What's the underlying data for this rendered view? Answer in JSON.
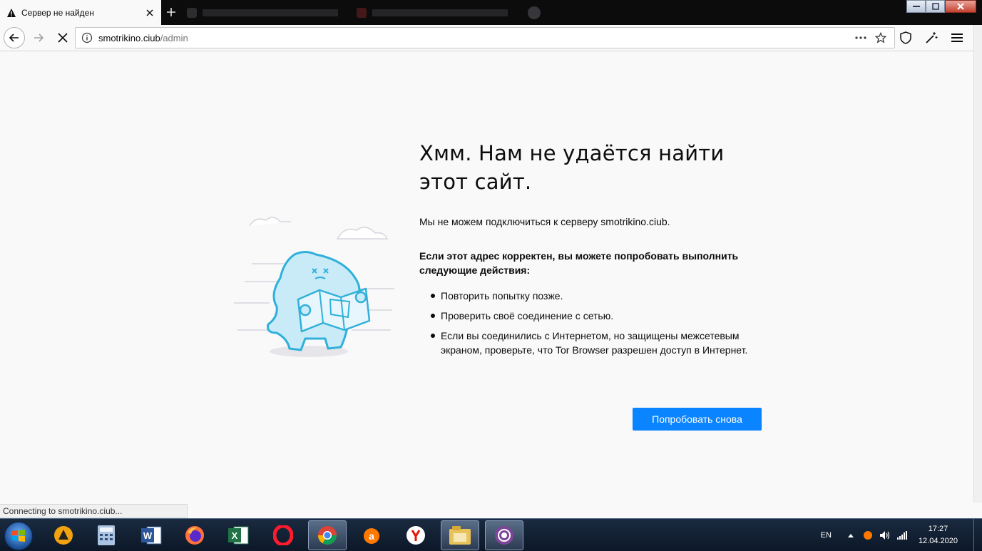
{
  "browser": {
    "active_tab_title": "Сервер не найден",
    "url_host": "smotrikino.ciub",
    "url_path": "/admin"
  },
  "error_page": {
    "title": "Хмм. Нам не удаётся найти этот сайт.",
    "description": "Мы не можем подключиться к серверу smotrikino.ciub.",
    "hint": "Если этот адрес корректен, вы можете попробовать выполнить следующие действия:",
    "tips": [
      "Повторить попытку позже.",
      "Проверить своё соединение с сетью.",
      "Если вы соединились с Интернетом, но защищены межсетевым экраном, проверьте, что Tor Browser разрешен доступ в Интернет."
    ],
    "retry_label": "Попробовать снова",
    "accent_color": "#0a84ff"
  },
  "status": {
    "text": "Connecting to smotrikino.ciub..."
  },
  "taskbar": {
    "apps": [
      "aimp-icon",
      "calculator-icon",
      "word-icon",
      "firefox-icon",
      "excel-icon",
      "opera-icon",
      "chrome-icon",
      "avast-icon",
      "yandex-icon",
      "explorer-icon",
      "tor-icon"
    ],
    "language": "EN",
    "time": "17:27",
    "date": "12.04.2020"
  }
}
